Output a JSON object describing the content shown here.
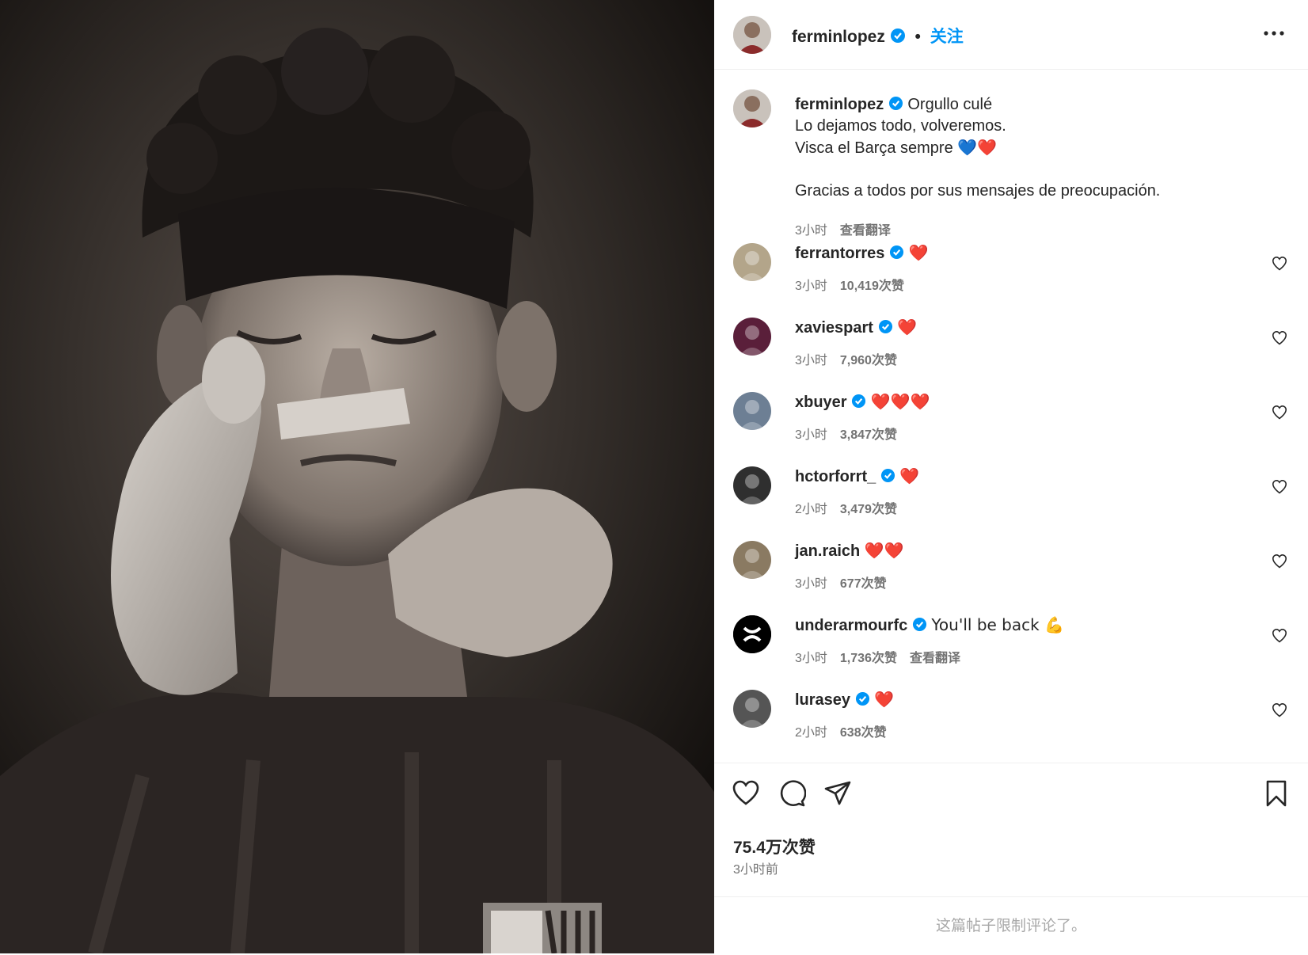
{
  "post": {
    "username": "ferminlopez",
    "follow_label": "关注",
    "caption_lines": [
      "Orgullo culé",
      "Lo dejamos todo, volveremos.",
      "Visca el Barça sempre",
      "",
      "Gracias a todos por sus mensajes de preocupación."
    ],
    "caption_emoji": "💙❤️",
    "caption_time": "3小时",
    "caption_translate": "查看翻译",
    "likes": "75.4万次赞",
    "time_ago": "3小时前",
    "comments_closed": "这篇帖子限制评论了。"
  },
  "comments": [
    {
      "user": "ferrantorres",
      "verified": true,
      "text": "❤️",
      "time": "3小时",
      "likes": "10,419次赞",
      "translate": ""
    },
    {
      "user": "xaviespart",
      "verified": true,
      "text": "❤️",
      "time": "3小时",
      "likes": "7,960次赞",
      "translate": ""
    },
    {
      "user": "xbuyer",
      "verified": true,
      "text": "❤️❤️❤️",
      "time": "3小时",
      "likes": "3,847次赞",
      "translate": ""
    },
    {
      "user": "hctorforrt_",
      "verified": true,
      "text": "❤️",
      "time": "2小时",
      "likes": "3,479次赞",
      "translate": ""
    },
    {
      "user": "jan.raich",
      "verified": false,
      "text": "❤️❤️",
      "time": "3小时",
      "likes": "677次赞",
      "translate": ""
    },
    {
      "user": "underarmourfc",
      "verified": true,
      "text": "You'll be back 💪",
      "time": "3小时",
      "likes": "1,736次赞",
      "translate": "查看翻译"
    },
    {
      "user": "lurasey",
      "verified": true,
      "text": "❤️",
      "time": "2小时",
      "likes": "638次赞",
      "translate": ""
    }
  ],
  "colors": {
    "accent": "#0095f6",
    "verified": "#0095f6",
    "heart": "#e0203b",
    "muted": "#737373"
  },
  "icons": [
    "more-icon",
    "verified-icon",
    "heart-icon",
    "comment-icon",
    "share-icon",
    "bookmark-icon"
  ]
}
